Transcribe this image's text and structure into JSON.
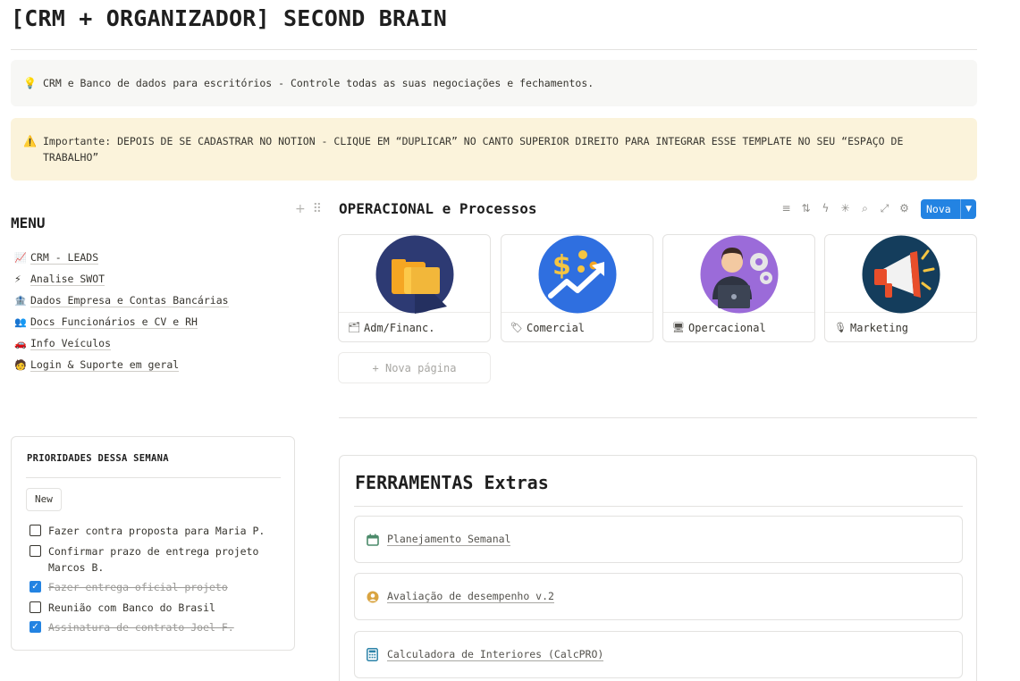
{
  "page": {
    "title": "[CRM + ORGANIZADOR] SECOND BRAIN"
  },
  "callouts": {
    "info": {
      "icon": "light-bulb-icon",
      "text": "CRM e Banco de dados para escritórios - Controle todas as suas negociações e fechamentos."
    },
    "warning": {
      "icon": "warning-icon",
      "text": "Importante:  DEPOIS DE SE CADASTRAR NO NOTION - CLIQUE EM “DUPLICAR”  NO CANTO SUPERIOR DIREITO PARA INTEGRAR ESSE TEMPLATE NO SEU “ESPAÇO DE TRABALHO”"
    }
  },
  "menu": {
    "heading": "MENU",
    "items": [
      {
        "label": "CRM - LEADS",
        "icon": "chart-increasing-icon",
        "glyph": "📈"
      },
      {
        "label": "Analise SWOT",
        "icon": "lightning-icon",
        "glyph": "⚡"
      },
      {
        "label": "Dados Empresa e Contas Bancárias",
        "icon": "bank-icon",
        "glyph": "🏦"
      },
      {
        "label": "Docs Funcionários e CV e RH",
        "icon": "people-icon",
        "glyph": "👥"
      },
      {
        "label": "Info Veículos",
        "icon": "car-icon",
        "glyph": "🚗"
      },
      {
        "label": "Login & Suporte em geral",
        "icon": "technician-icon",
        "glyph": "🧑"
      }
    ]
  },
  "priorities": {
    "title": "PRIORIDADES DESSA SEMANA",
    "new_label": "New",
    "items": [
      {
        "label": "Fazer contra proposta para Maria P.",
        "done": false
      },
      {
        "label": "Confirmar prazo de entrega projeto Marcos B.",
        "done": false
      },
      {
        "label": "Fazer entrega oficial projeto ",
        "done": true
      },
      {
        "label": "Reunião com Banco do Brasil",
        "done": false
      },
      {
        "label": "Assinatura de contrato Joel F.",
        "done": true
      }
    ]
  },
  "operacional": {
    "title": "OPERACIONAL e Processos",
    "new_button": "Nova",
    "new_page": "+ Nova página",
    "cards": [
      {
        "label": "Adm/Financ.",
        "icon": "folder-icon",
        "colors": {
          "bg": "#2d3a73",
          "fg": "#f5a623"
        }
      },
      {
        "label": "Comercial",
        "icon": "tag-icon",
        "colors": {
          "bg": "#2f6fe0",
          "fg": "#f5c542"
        }
      },
      {
        "label": "Opercacional",
        "icon": "monitor-icon",
        "colors": {
          "bg": "#9b6bd9",
          "fg": "#e6e6e6"
        }
      },
      {
        "label": "Marketing",
        "icon": "microphone-icon",
        "colors": {
          "bg": "#143d5c",
          "fg": "#e94e2b"
        }
      }
    ]
  },
  "ferramentas": {
    "title": "FERRAMENTAS Extras",
    "items": [
      {
        "label": "Planejamento Semanal",
        "icon": "calendar-icon",
        "color": "#4c8b6b"
      },
      {
        "label": "Avaliação de desempenho v.2",
        "icon": "user-circle-icon",
        "color": "#d9a441"
      },
      {
        "label": "Calculadora de Interiores (CalcPRO)",
        "icon": "calculator-icon",
        "color": "#2c83a8"
      }
    ]
  },
  "colors": {
    "accent": "#2383e2",
    "warning_bg": "#fbf3db",
    "info_bg": "#f7f7f5"
  }
}
